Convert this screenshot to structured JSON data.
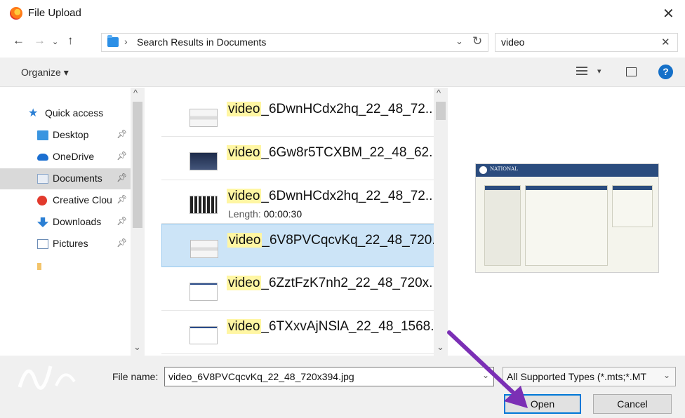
{
  "window": {
    "title": "File Upload"
  },
  "address": {
    "crumb_separator": "›",
    "location": "Search Results in Documents"
  },
  "search": {
    "value": "video"
  },
  "toolbar": {
    "organize_label": "Organize ▾"
  },
  "nav": {
    "items": [
      {
        "label": "Quick access",
        "icon": "star-icon"
      },
      {
        "label": "Desktop",
        "icon": "desktop-folder-icon"
      },
      {
        "label": "OneDrive",
        "icon": "onedrive-cloud-icon"
      },
      {
        "label": "Documents",
        "icon": "documents-folder-icon"
      },
      {
        "label": "Creative Clou",
        "icon": "creative-cloud-icon"
      },
      {
        "label": "Downloads",
        "icon": "downloads-folder-icon"
      },
      {
        "label": "Pictures",
        "icon": "pictures-folder-icon"
      }
    ]
  },
  "files": [
    {
      "highlight": "video",
      "rest": "_6DwnHCdx2hq_22_48_72...",
      "thumb": "doc"
    },
    {
      "highlight": "video",
      "rest": "_6Gw8r5TCXBM_22_48_62...",
      "thumb": "dark"
    },
    {
      "highlight": "video",
      "rest": "_6DwnHCdx2hq_22_48_72...",
      "thumb": "film",
      "meta_label": "Length:",
      "meta_value": "00:00:30"
    },
    {
      "highlight": "video",
      "rest": "_6V8PVCqcvKq_22_48_720...",
      "thumb": "doc"
    },
    {
      "highlight": "video",
      "rest": "_6ZztFzK7nh2_22_48_720x...",
      "thumb": "blank"
    },
    {
      "highlight": "video",
      "rest": "_6TXxvAjNSlA_22_48_1568...",
      "thumb": "blank"
    }
  ],
  "preview": {
    "logo_text": "NATIONAL"
  },
  "footer": {
    "filename_label": "File name:",
    "filename_value": "video_6V8PVCqcvKq_22_48_720x394.jpg",
    "filetype_value": "All Supported Types (*.mts;*.MT",
    "open_label": "Open",
    "cancel_label": "Cancel"
  },
  "colors": {
    "accent": "#0078d7",
    "selection": "#cce4f7",
    "highlight": "#fff6a3",
    "annotation_arrow": "#7b2fb5"
  }
}
